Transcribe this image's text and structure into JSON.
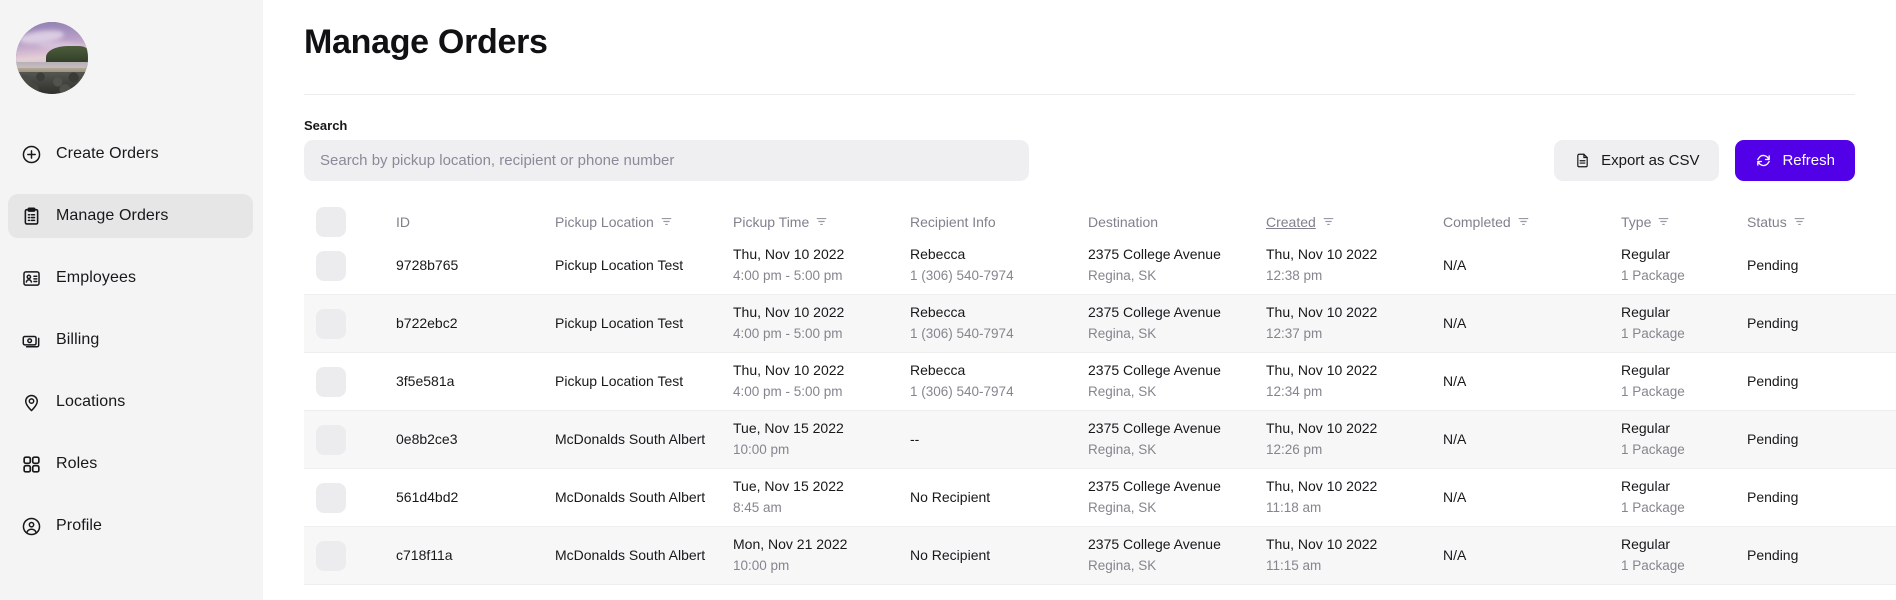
{
  "sidebar": {
    "avatar_alt": "user-avatar-photo",
    "items": [
      {
        "label": "Create Orders",
        "icon": "plus-circle-icon",
        "active": false
      },
      {
        "label": "Manage Orders",
        "icon": "clipboard-list-icon",
        "active": true
      },
      {
        "label": "Employees",
        "icon": "id-badge-icon",
        "active": false
      },
      {
        "label": "Billing",
        "icon": "cash-stack-icon",
        "active": false
      },
      {
        "label": "Locations",
        "icon": "map-pin-icon",
        "active": false
      },
      {
        "label": "Roles",
        "icon": "grid-squares-icon",
        "active": false
      },
      {
        "label": "Profile",
        "icon": "user-circle-icon",
        "active": false
      }
    ]
  },
  "header": {
    "title": "Manage Orders"
  },
  "search": {
    "label": "Search",
    "value": "",
    "placeholder": "Search by pickup location, recipient or phone number"
  },
  "actions": {
    "export_label": "Export as CSV",
    "export_icon": "document-icon",
    "refresh_label": "Refresh",
    "refresh_icon": "refresh-icon",
    "primary_color": "#5200e8"
  },
  "table": {
    "columns": [
      {
        "key": "id",
        "label": "ID",
        "filter": false,
        "sorted": false
      },
      {
        "key": "pickup",
        "label": "Pickup Location",
        "filter": true,
        "sorted": false
      },
      {
        "key": "time",
        "label": "Pickup Time",
        "filter": true,
        "sorted": false
      },
      {
        "key": "recipient",
        "label": "Recipient Info",
        "filter": false,
        "sorted": false
      },
      {
        "key": "dest",
        "label": "Destination",
        "filter": false,
        "sorted": false
      },
      {
        "key": "created",
        "label": "Created",
        "filter": true,
        "sorted": true
      },
      {
        "key": "completed",
        "label": "Completed",
        "filter": true,
        "sorted": false
      },
      {
        "key": "type",
        "label": "Type",
        "filter": true,
        "sorted": false
      },
      {
        "key": "status",
        "label": "Status",
        "filter": true,
        "sorted": false
      }
    ],
    "rows": [
      {
        "id": "9728b765",
        "pickup_location": "Pickup Location Test",
        "pickup_date": "Thu, Nov 10 2022",
        "pickup_time": "4:00 pm - 5:00 pm",
        "recipient_name": "Rebecca",
        "recipient_phone": "1 (306) 540-7974",
        "destination_street": "2375 College Avenue",
        "destination_city": "Regina, SK",
        "created_date": "Thu, Nov 10 2022",
        "created_time": "12:38 pm",
        "completed": "N/A",
        "type": "Regular",
        "type_sub": "1 Package",
        "status": "Pending"
      },
      {
        "id": "b722ebc2",
        "pickup_location": "Pickup Location Test",
        "pickup_date": "Thu, Nov 10 2022",
        "pickup_time": "4:00 pm - 5:00 pm",
        "recipient_name": "Rebecca",
        "recipient_phone": "1 (306) 540-7974",
        "destination_street": "2375 College Avenue",
        "destination_city": "Regina, SK",
        "created_date": "Thu, Nov 10 2022",
        "created_time": "12:37 pm",
        "completed": "N/A",
        "type": "Regular",
        "type_sub": "1 Package",
        "status": "Pending"
      },
      {
        "id": "3f5e581a",
        "pickup_location": "Pickup Location Test",
        "pickup_date": "Thu, Nov 10 2022",
        "pickup_time": "4:00 pm - 5:00 pm",
        "recipient_name": "Rebecca",
        "recipient_phone": "1 (306) 540-7974",
        "destination_street": "2375 College Avenue",
        "destination_city": "Regina, SK",
        "created_date": "Thu, Nov 10 2022",
        "created_time": "12:34 pm",
        "completed": "N/A",
        "type": "Regular",
        "type_sub": "1 Package",
        "status": "Pending"
      },
      {
        "id": "0e8b2ce3",
        "pickup_location": "McDonalds South Albert",
        "pickup_date": "Tue, Nov 15 2022",
        "pickup_time": "10:00 pm",
        "recipient_name": "--",
        "recipient_phone": "",
        "destination_street": "2375 College Avenue",
        "destination_city": "Regina, SK",
        "created_date": "Thu, Nov 10 2022",
        "created_time": "12:26 pm",
        "completed": "N/A",
        "type": "Regular",
        "type_sub": "1 Package",
        "status": "Pending"
      },
      {
        "id": "561d4bd2",
        "pickup_location": "McDonalds South Albert",
        "pickup_date": "Tue, Nov 15 2022",
        "pickup_time": "8:45 am",
        "recipient_name": "No Recipient",
        "recipient_phone": "",
        "destination_street": "2375 College Avenue",
        "destination_city": "Regina, SK",
        "created_date": "Thu, Nov 10 2022",
        "created_time": "11:18 am",
        "completed": "N/A",
        "type": "Regular",
        "type_sub": "1 Package",
        "status": "Pending"
      },
      {
        "id": "c718f11a",
        "pickup_location": "McDonalds South Albert",
        "pickup_date": "Mon, Nov 21 2022",
        "pickup_time": "10:00 pm",
        "recipient_name": "No Recipient",
        "recipient_phone": "",
        "destination_street": "2375 College Avenue",
        "destination_city": "Regina, SK",
        "created_date": "Thu, Nov 10 2022",
        "created_time": "11:15 am",
        "completed": "N/A",
        "type": "Regular",
        "type_sub": "1 Package",
        "status": "Pending"
      }
    ]
  }
}
